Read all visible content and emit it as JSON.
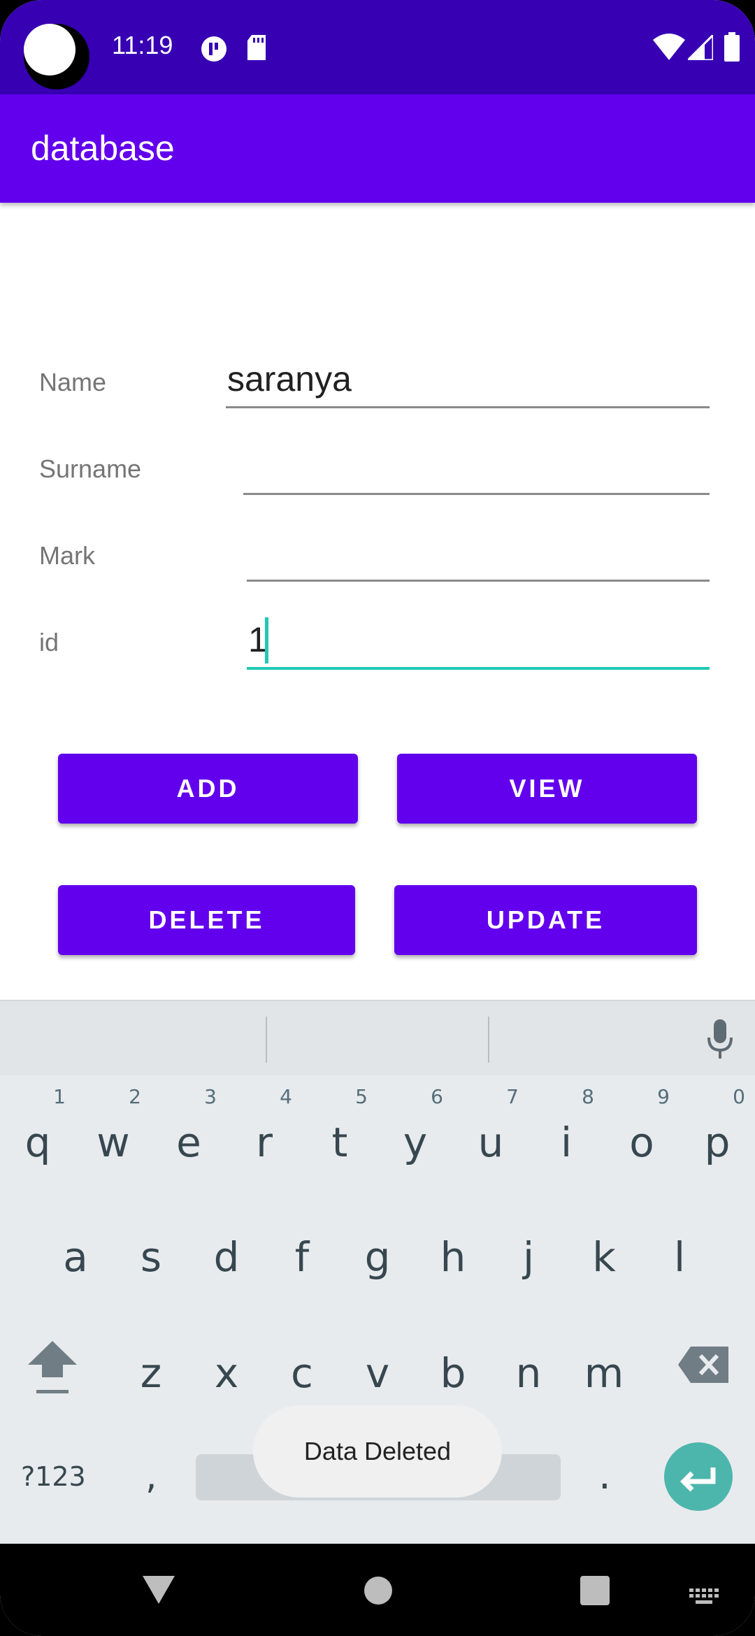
{
  "status_bar": {
    "time": "11:19"
  },
  "app_bar": {
    "title": "database"
  },
  "form": {
    "name_label": "Name",
    "name_value": "saranya",
    "surname_label": "Surname",
    "surname_value": "",
    "mark_label": "Mark",
    "mark_value": "",
    "id_label": "id",
    "id_value": "1"
  },
  "buttons": {
    "add": "ADD",
    "view": "VIEW",
    "delete": "DELETE",
    "update": "UPDATE"
  },
  "keyboard": {
    "row1": [
      {
        "ch": "q",
        "hint": "1"
      },
      {
        "ch": "w",
        "hint": "2"
      },
      {
        "ch": "e",
        "hint": "3"
      },
      {
        "ch": "r",
        "hint": "4"
      },
      {
        "ch": "t",
        "hint": "5"
      },
      {
        "ch": "y",
        "hint": "6"
      },
      {
        "ch": "u",
        "hint": "7"
      },
      {
        "ch": "i",
        "hint": "8"
      },
      {
        "ch": "o",
        "hint": "9"
      },
      {
        "ch": "p",
        "hint": "0"
      }
    ],
    "row2": [
      "a",
      "s",
      "d",
      "f",
      "g",
      "h",
      "j",
      "k",
      "l"
    ],
    "row3": [
      "z",
      "x",
      "c",
      "v",
      "b",
      "n",
      "m"
    ],
    "symbols_label": "?123",
    "comma": ",",
    "period": "."
  },
  "toast": {
    "message": "Data Deleted"
  },
  "colors": {
    "status_bar": "#3700b3",
    "primary": "#6200ee",
    "focus_accent": "#20c9b5",
    "enter_key": "#4db6ac"
  }
}
